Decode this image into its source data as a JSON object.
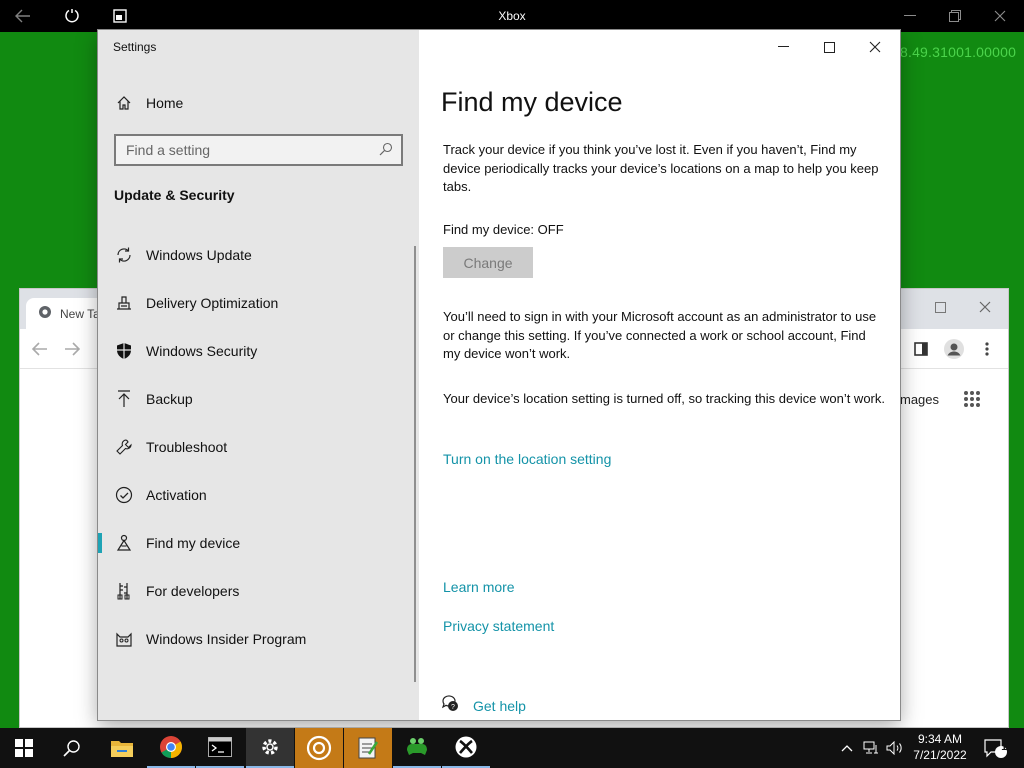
{
  "xbox_bar": {
    "title": "Xbox",
    "version_text": "8.49.31001.00000",
    "icons": [
      "back-arrow-icon",
      "refresh-icon",
      "compact-overlay-icon",
      "minimize-icon",
      "restore-icon",
      "close-icon"
    ]
  },
  "chrome": {
    "tab_title": "New Ta",
    "images_link": "mages"
  },
  "settings": {
    "window_title": "Settings",
    "home_label": "Home",
    "search_placeholder": "Find a setting",
    "section_heading": "Update & Security",
    "nav_items": [
      {
        "label": "Windows Update",
        "icon": "sync-icon"
      },
      {
        "label": "Delivery Optimization",
        "icon": "delivery-optimization-icon"
      },
      {
        "label": "Windows Security",
        "icon": "shield-icon"
      },
      {
        "label": "Backup",
        "icon": "backup-arrow-icon"
      },
      {
        "label": "Troubleshoot",
        "icon": "wrench-icon"
      },
      {
        "label": "Activation",
        "icon": "check-circle-icon"
      },
      {
        "label": "Find my device",
        "icon": "find-device-icon",
        "active": true
      },
      {
        "label": "For developers",
        "icon": "developer-tools-icon"
      },
      {
        "label": "Windows Insider Program",
        "icon": "insider-cat-icon"
      }
    ],
    "content": {
      "title": "Find my device",
      "description": "Track your device if you think you’ve lost it. Even if you haven’t, Find my device periodically tracks your device’s locations on a map to help you keep tabs.",
      "status": "Find my device: OFF",
      "change_button": "Change",
      "signin_note": "You’ll need to sign in with your Microsoft account as an administrator to use or change this setting. If you’ve connected a work or school account, Find my device won’t work.",
      "location_note": "Your device’s location setting is turned off, so tracking this device won’t work.",
      "location_link": "Turn on the location setting",
      "learn_more": "Learn more",
      "privacy": "Privacy statement",
      "get_help": "Get help"
    }
  },
  "taskbar": {
    "time": "9:34 AM",
    "date": "7/21/2022",
    "notification_count": "1",
    "accent_color": "#c47a17"
  },
  "colors": {
    "desktop": "#118a11",
    "link": "#1493a8",
    "nav_accent": "#1ea3b5"
  }
}
